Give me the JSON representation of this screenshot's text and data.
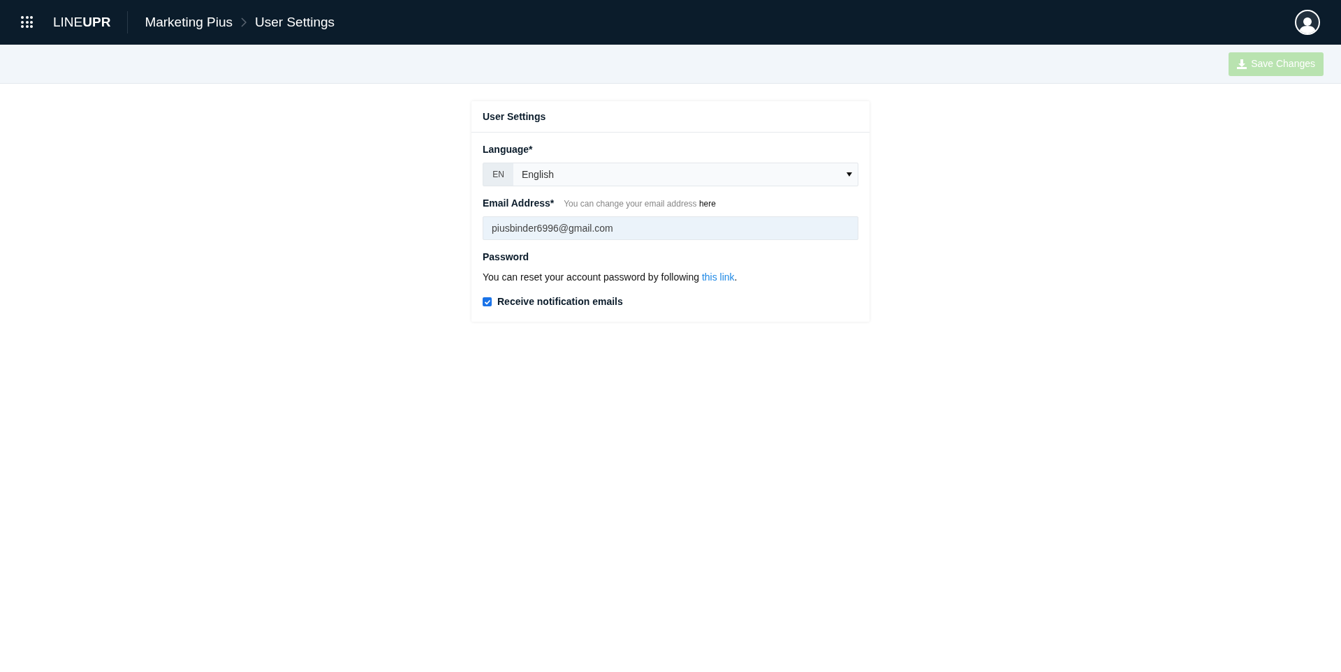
{
  "header": {
    "logo": "LINE**UPR**",
    "breadcrumb": [
      {
        "label": "Marketing Pius"
      },
      {
        "label": "User Settings"
      }
    ]
  },
  "toolbar": {
    "save_button": {
      "label": "Save Changes",
      "disabled": true
    }
  },
  "card": {
    "title": "User Settings",
    "language": {
      "label": "Language*",
      "code": "EN",
      "value": "English"
    },
    "email": {
      "label": "Email Address*",
      "hint": "You can change your email address",
      "hint_link": "here",
      "value": "piusbinder6996@gmail.com"
    },
    "password": {
      "label": "Password",
      "text_before": "You can reset your account password by following",
      "link": "this link",
      "text_after": "."
    },
    "notifications": {
      "label": "Receive notification emails",
      "checked": true
    }
  }
}
